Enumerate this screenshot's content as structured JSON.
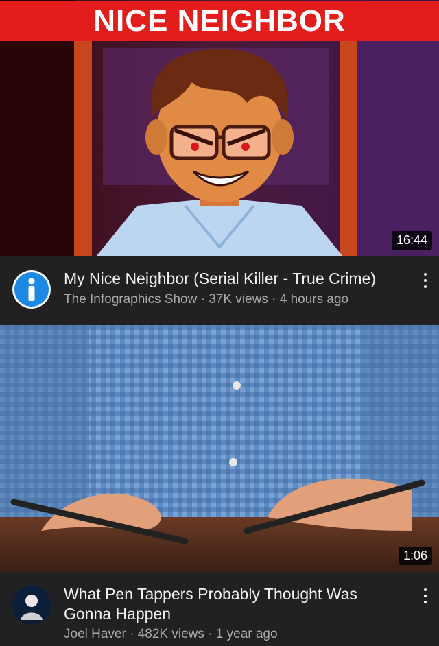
{
  "videos": [
    {
      "thumbnail_title": "NICE NEIGHBOR",
      "duration": "16:44",
      "title": "My Nice Neighbor (Serial Killer - True Crime)",
      "channel": "The Infographics Show",
      "views": "37K views",
      "age": "4 hours ago",
      "separator": " · ",
      "avatar_letter": "i",
      "avatar_color": "#1e88e5"
    },
    {
      "duration": "1:06",
      "title": "What Pen Tappers Probably Thought Was Gonna Happen",
      "channel": "Joel Haver",
      "views": "482K views",
      "age": "1 year ago",
      "separator": " · "
    }
  ],
  "colors": {
    "background": "#212121",
    "thumb_banner": "#e31c1c",
    "secondary_text": "#aaaaaa"
  },
  "icons": [
    "more-vert-icon",
    "channel-avatar"
  ]
}
